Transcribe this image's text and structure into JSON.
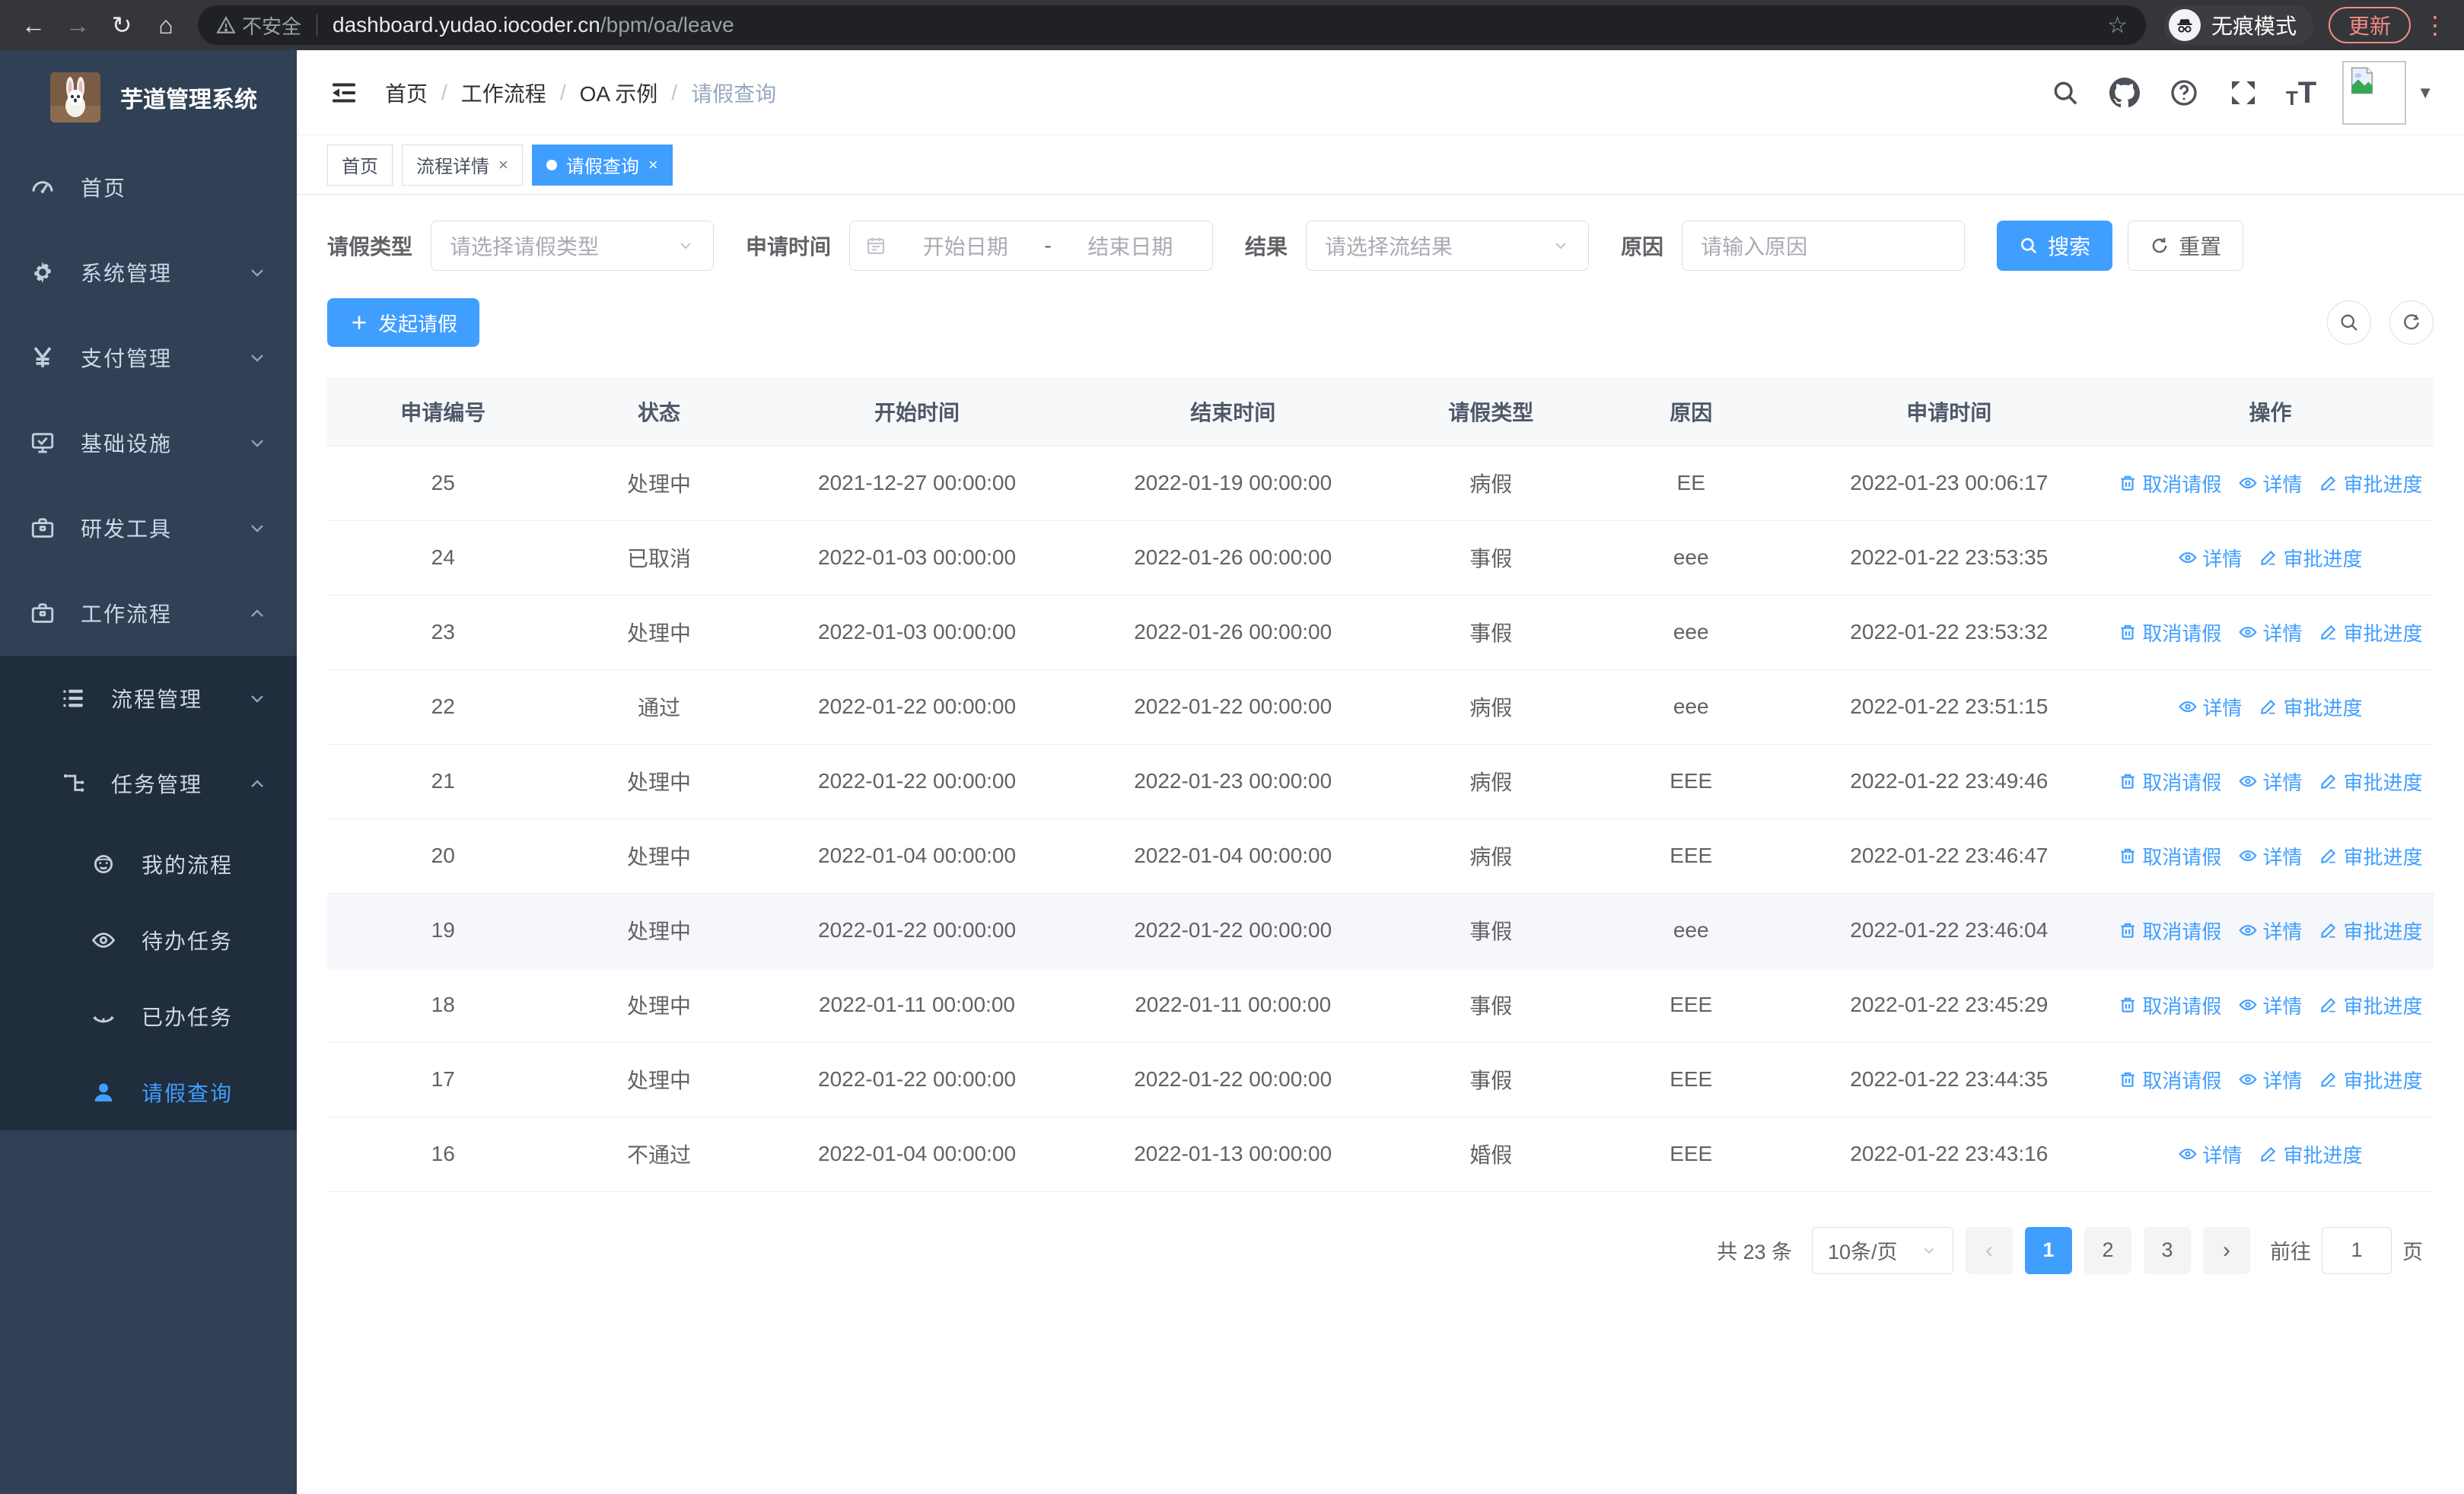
{
  "browser": {
    "security_warning": "不安全",
    "url_domain": "dashboard.yudao.iocoder.cn",
    "url_path": "/bpm/oa/leave",
    "incognito_label": "无痕模式",
    "update_label": "更新"
  },
  "sidebar": {
    "title": "芋道管理系统",
    "items": [
      {
        "label": "首页",
        "icon": "dashboard-icon",
        "level": 1
      },
      {
        "label": "系统管理",
        "icon": "gear-icon",
        "level": 1,
        "chevron": "down"
      },
      {
        "label": "支付管理",
        "icon": "yen-icon",
        "level": 1,
        "chevron": "down"
      },
      {
        "label": "基础设施",
        "icon": "monitor-icon",
        "level": 1,
        "chevron": "down"
      },
      {
        "label": "研发工具",
        "icon": "briefcase-icon",
        "level": 1,
        "chevron": "down"
      },
      {
        "label": "工作流程",
        "icon": "briefcase-icon",
        "level": 1,
        "chevron": "up"
      },
      {
        "label": "流程管理",
        "icon": "list-icon",
        "level": 2,
        "chevron": "down"
      },
      {
        "label": "任务管理",
        "icon": "tree-icon",
        "level": 2,
        "chevron": "up"
      },
      {
        "label": "我的流程",
        "icon": "robot-icon",
        "level": 3
      },
      {
        "label": "待办任务",
        "icon": "eye-icon",
        "level": 3
      },
      {
        "label": "已办任务",
        "icon": "eye-closed-icon",
        "level": 3
      },
      {
        "label": "请假查询",
        "icon": "user-icon",
        "level": 3,
        "active": true
      }
    ]
  },
  "header": {
    "breadcrumb": [
      "首页",
      "工作流程",
      "OA 示例",
      "请假查询"
    ]
  },
  "tabs": [
    {
      "label": "首页",
      "closable": false,
      "active": false
    },
    {
      "label": "流程详情",
      "closable": true,
      "active": false
    },
    {
      "label": "请假查询",
      "closable": true,
      "active": true
    }
  ],
  "filters": {
    "type_label": "请假类型",
    "type_placeholder": "请选择请假类型",
    "time_label": "申请时间",
    "date_start_placeholder": "开始日期",
    "date_separator": "-",
    "date_end_placeholder": "结束日期",
    "result_label": "结果",
    "result_placeholder": "请选择流结果",
    "reason_label": "原因",
    "reason_placeholder": "请输入原因",
    "search_label": "搜索",
    "reset_label": "重置"
  },
  "toolbar": {
    "create_label": "发起请假"
  },
  "table": {
    "columns": [
      "申请编号",
      "状态",
      "开始时间",
      "结束时间",
      "请假类型",
      "原因",
      "申请时间",
      "操作"
    ],
    "action_labels": {
      "cancel": "取消请假",
      "detail": "详情",
      "progress": "审批进度"
    },
    "rows": [
      {
        "id": "25",
        "status": "处理中",
        "start": "2021-12-27 00:00:00",
        "end": "2022-01-19 00:00:00",
        "type": "病假",
        "reason": "EE",
        "apply": "2022-01-23 00:06:17",
        "actions": [
          "cancel",
          "detail",
          "progress"
        ],
        "highlight": false
      },
      {
        "id": "24",
        "status": "已取消",
        "start": "2022-01-03 00:00:00",
        "end": "2022-01-26 00:00:00",
        "type": "事假",
        "reason": "eee",
        "apply": "2022-01-22 23:53:35",
        "actions": [
          "detail",
          "progress"
        ],
        "highlight": false
      },
      {
        "id": "23",
        "status": "处理中",
        "start": "2022-01-03 00:00:00",
        "end": "2022-01-26 00:00:00",
        "type": "事假",
        "reason": "eee",
        "apply": "2022-01-22 23:53:32",
        "actions": [
          "cancel",
          "detail",
          "progress"
        ],
        "highlight": false
      },
      {
        "id": "22",
        "status": "通过",
        "start": "2022-01-22 00:00:00",
        "end": "2022-01-22 00:00:00",
        "type": "病假",
        "reason": "eee",
        "apply": "2022-01-22 23:51:15",
        "actions": [
          "detail",
          "progress"
        ],
        "highlight": false
      },
      {
        "id": "21",
        "status": "处理中",
        "start": "2022-01-22 00:00:00",
        "end": "2022-01-23 00:00:00",
        "type": "病假",
        "reason": "EEE",
        "apply": "2022-01-22 23:49:46",
        "actions": [
          "cancel",
          "detail",
          "progress"
        ],
        "highlight": false
      },
      {
        "id": "20",
        "status": "处理中",
        "start": "2022-01-04 00:00:00",
        "end": "2022-01-04 00:00:00",
        "type": "病假",
        "reason": "EEE",
        "apply": "2022-01-22 23:46:47",
        "actions": [
          "cancel",
          "detail",
          "progress"
        ],
        "highlight": false
      },
      {
        "id": "19",
        "status": "处理中",
        "start": "2022-01-22 00:00:00",
        "end": "2022-01-22 00:00:00",
        "type": "事假",
        "reason": "eee",
        "apply": "2022-01-22 23:46:04",
        "actions": [
          "cancel",
          "detail",
          "progress"
        ],
        "highlight": true
      },
      {
        "id": "18",
        "status": "处理中",
        "start": "2022-01-11 00:00:00",
        "end": "2022-01-11 00:00:00",
        "type": "事假",
        "reason": "EEE",
        "apply": "2022-01-22 23:45:29",
        "actions": [
          "cancel",
          "detail",
          "progress"
        ],
        "highlight": false
      },
      {
        "id": "17",
        "status": "处理中",
        "start": "2022-01-22 00:00:00",
        "end": "2022-01-22 00:00:00",
        "type": "事假",
        "reason": "EEE",
        "apply": "2022-01-22 23:44:35",
        "actions": [
          "cancel",
          "detail",
          "progress"
        ],
        "highlight": false
      },
      {
        "id": "16",
        "status": "不通过",
        "start": "2022-01-04 00:00:00",
        "end": "2022-01-13 00:00:00",
        "type": "婚假",
        "reason": "EEE",
        "apply": "2022-01-22 23:43:16",
        "actions": [
          "detail",
          "progress"
        ],
        "highlight": false
      }
    ]
  },
  "pagination": {
    "total": "共 23 条",
    "page_size": "10条/页",
    "pages": [
      "1",
      "2",
      "3"
    ],
    "active_page": "1",
    "goto_label": "前往",
    "goto_value": "1",
    "goto_suffix": "页"
  },
  "colors": {
    "accent": "#409eff",
    "sidebar_bg": "#304156",
    "submenu_bg": "#1f2d3d",
    "chrome_bar": "#35363a",
    "chrome_coral": "#f28b82"
  }
}
